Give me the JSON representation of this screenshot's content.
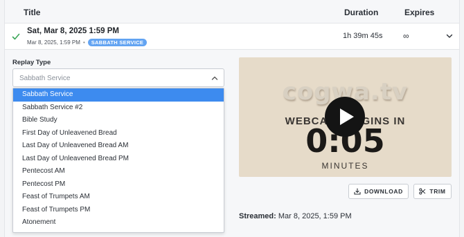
{
  "table": {
    "headers": {
      "title": "Title",
      "duration": "Duration",
      "expires": "Expires"
    }
  },
  "row": {
    "title": "Sat, Mar 8, 2025 1:59 PM",
    "subtitle": "Mar 8, 2025, 1:59 PM",
    "separator": "•",
    "badge": "SABBATH SERVICE",
    "duration": "1h 39m 45s",
    "expires": "∞"
  },
  "replay": {
    "label": "Replay Type",
    "selected_value": "Sabbath Service",
    "options": [
      "Sabbath Service",
      "Sabbath Service #2",
      "Bible Study",
      "First Day of Unleavened Bread",
      "Last Day of Unleavened Bread AM",
      "Last Day of Unleavened Bread PM",
      "Pentecost AM",
      "Pentecost PM",
      "Feast of Trumpets AM",
      "Feast of Trumpets PM",
      "Atonement"
    ]
  },
  "video": {
    "logo_text": "cogwa.tv",
    "subtitle_text": "WEBCAST BEGINS IN",
    "countdown": "0:05",
    "unit": "MINUTES"
  },
  "actions": {
    "download_label": "DOWNLOAD",
    "trim_label": "TRIM"
  },
  "streamed": {
    "label": "Streamed:",
    "value": "Mar 8, 2025, 1:59 PM"
  },
  "colors": {
    "accent": "#3d8bef",
    "badge": "#63a4f2",
    "check": "#3aa657"
  }
}
